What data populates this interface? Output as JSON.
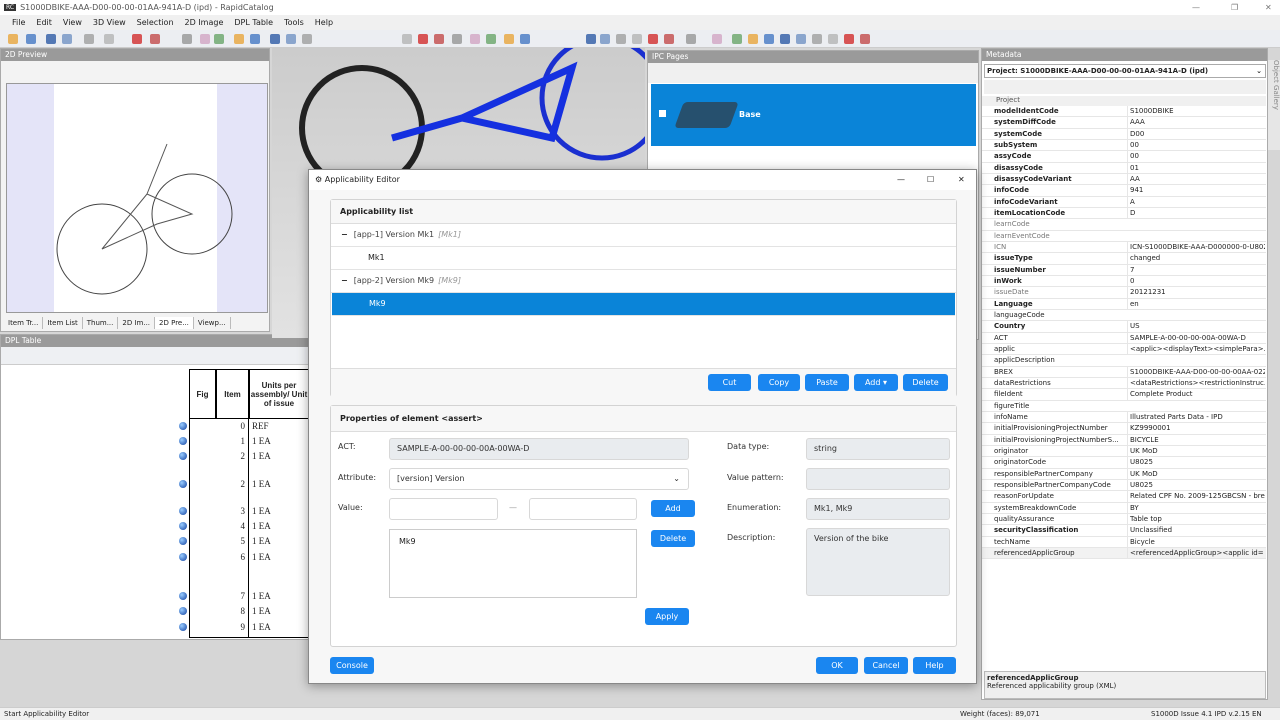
{
  "window": {
    "title": "S1000DBIKE-AAA-D00-00-00-01AA-941A-D (ipd) - RapidCatalog",
    "app_icon": "RC"
  },
  "menu": [
    "File",
    "Edit",
    "View",
    "3D View",
    "Selection",
    "2D Image",
    "DPL Table",
    "Tools",
    "Help"
  ],
  "preview_panel": {
    "title": "2D Preview",
    "tabs": [
      "Item Tr...",
      "Item List",
      "Thum...",
      "2D Im...",
      "2D Pre...",
      "Viewp..."
    ],
    "active_tab": 4
  },
  "dpl": {
    "title": "DPL Table",
    "headers": [
      "Fig",
      "Item",
      "Units per assembly/ Unit of issue"
    ],
    "rows": [
      {
        "item": "0",
        "units": "REF"
      },
      {
        "item": "1",
        "units": "1 EA"
      },
      {
        "item": "2",
        "units": "1 EA"
      },
      {
        "item": "2",
        "units": "1 EA"
      },
      {
        "item": "3",
        "units": "1 EA"
      },
      {
        "item": "4",
        "units": "1 EA"
      },
      {
        "item": "5",
        "units": "1 EA"
      },
      {
        "item": "6",
        "units": "1 EA"
      },
      {
        "item": "7",
        "units": "1 EA"
      },
      {
        "item": "8",
        "units": "1 EA"
      },
      {
        "item": "9",
        "units": "1 EA"
      }
    ]
  },
  "ipc": {
    "title": "IPC Pages",
    "selected": "Base"
  },
  "metadata": {
    "title": "Metadata",
    "project": "Project: S1000DBIKE-AAA-D00-00-00-01AA-941A-D (ipd)",
    "group": "Project",
    "rows": [
      {
        "n": "modelIdentCode",
        "v": "S1000DBIKE",
        "s": "b"
      },
      {
        "n": "systemDiffCode",
        "v": "AAA",
        "s": "b"
      },
      {
        "n": "systemCode",
        "v": "D00",
        "s": "b"
      },
      {
        "n": "subSystem",
        "v": "00",
        "s": "b"
      },
      {
        "n": "assyCode",
        "v": "00",
        "s": "b"
      },
      {
        "n": "disassyCode",
        "v": "01",
        "s": "b"
      },
      {
        "n": "disassyCodeVariant",
        "v": "AA",
        "s": "b"
      },
      {
        "n": "infoCode",
        "v": "941",
        "s": "b"
      },
      {
        "n": "infoCodeVariant",
        "v": "A",
        "s": "b"
      },
      {
        "n": "itemLocationCode",
        "v": "D",
        "s": "b"
      },
      {
        "n": "learnCode",
        "v": "",
        "s": "g"
      },
      {
        "n": "learnEventCode",
        "v": "",
        "s": "g"
      },
      {
        "n": "ICN",
        "v": "ICN-S1000DBIKE-AAA-D000000-0-U802...",
        "s": "g"
      },
      {
        "n": "issueType",
        "v": "changed",
        "s": "b"
      },
      {
        "n": "issueNumber",
        "v": "7",
        "s": "b"
      },
      {
        "n": "inWork",
        "v": "0",
        "s": "b"
      },
      {
        "n": "issueDate",
        "v": "20121231",
        "s": "g"
      },
      {
        "n": "Language",
        "v": "en",
        "s": "b"
      },
      {
        "n": "languageCode",
        "v": "",
        "s": "n"
      },
      {
        "n": "Country",
        "v": "US",
        "s": "b"
      },
      {
        "n": "ACT",
        "v": "SAMPLE-A-00-00-00-00A-00WA-D",
        "s": "n"
      },
      {
        "n": "applic",
        "v": "<applic><displayText><simplePara>...",
        "s": "n"
      },
      {
        "n": "applicDescription",
        "v": "",
        "s": "n"
      },
      {
        "n": "BREX",
        "v": "S1000DBIKE-AAA-D00-00-00-00AA-022...",
        "s": "n"
      },
      {
        "n": "dataRestrictions",
        "v": "<dataRestrictions><restrictionInstruc...",
        "s": "n"
      },
      {
        "n": "fileIdent",
        "v": "Complete Product",
        "s": "n"
      },
      {
        "n": "figureTitle",
        "v": "",
        "s": "n"
      },
      {
        "n": "infoName",
        "v": "Illustrated Parts Data - IPD",
        "s": "n"
      },
      {
        "n": "initialProvisioningProjectNumber",
        "v": "KZ9990001",
        "s": "n"
      },
      {
        "n": "initialProvisioningProjectNumberS...",
        "v": "BICYCLE",
        "s": "n"
      },
      {
        "n": "originator",
        "v": "UK MoD",
        "s": "n"
      },
      {
        "n": "originatorCode",
        "v": "U8025",
        "s": "n"
      },
      {
        "n": "responsiblePartnerCompany",
        "v": "UK MoD",
        "s": "n"
      },
      {
        "n": "responsiblePartnerCompanyCode",
        "v": "U8025",
        "s": "n"
      },
      {
        "n": "reasonForUpdate",
        "v": "Related CPF No. 2009-125GBCSN - bre...",
        "s": "n"
      },
      {
        "n": "systemBreakdownCode",
        "v": "BY",
        "s": "n"
      },
      {
        "n": "qualityAssurance",
        "v": "Table top",
        "s": "n"
      },
      {
        "n": "securityClassification",
        "v": "Unclassified",
        "s": "b"
      },
      {
        "n": "techName",
        "v": "Bicycle",
        "s": "n"
      },
      {
        "n": "referencedApplicGroup",
        "v": "<referencedApplicGroup><applic id=",
        "s": "n"
      }
    ],
    "desc_title": "referencedApplicGroup",
    "desc_text": "Referenced applicability group (XML)",
    "side_tab": "Object Gallery"
  },
  "dialog": {
    "title": "Applicability Editor",
    "list_title": "Applicability list",
    "items": [
      {
        "type": "group",
        "label": "[app-1] Version Mk1",
        "tag": "[Mk1]"
      },
      {
        "type": "value",
        "label": "Mk1"
      },
      {
        "type": "group",
        "label": "[app-2] Version Mk9",
        "tag": "[Mk9]"
      },
      {
        "type": "value",
        "label": "Mk9",
        "selected": true
      }
    ],
    "list_buttons": [
      "Cut",
      "Copy",
      "Paste",
      "Add ▾",
      "Delete"
    ],
    "props_title": "Properties of element <assert>",
    "act_label": "ACT:",
    "act_value": "SAMPLE-A-00-00-00-00A-00WA-D",
    "attr_label": "Attribute:",
    "attr_value": "[version] Version",
    "value_label": "Value:",
    "range_from": "",
    "range_to": "",
    "range_sep": "—",
    "add": "Add",
    "delete": "Delete",
    "apply": "Apply",
    "values_list": [
      "Mk9"
    ],
    "dtype_label": "Data type:",
    "dtype_value": "string",
    "pattern_label": "Value pattern:",
    "pattern_value": "",
    "enum_label": "Enumeration:",
    "enum_value": "Mk1, Mk9",
    "desc_label": "Description:",
    "desc_value": "Version of the bike",
    "console": "Console",
    "ok": "OK",
    "cancel": "Cancel",
    "help": "Help"
  },
  "status": {
    "left": "Start Applicability Editor",
    "weight": "Weight (faces): 89,071",
    "version": "S1000D Issue 4.1 IPD v.2.15",
    "lang": "EN"
  },
  "colors": {
    "accent": "#0a84d8",
    "button": "#1a86f0"
  }
}
